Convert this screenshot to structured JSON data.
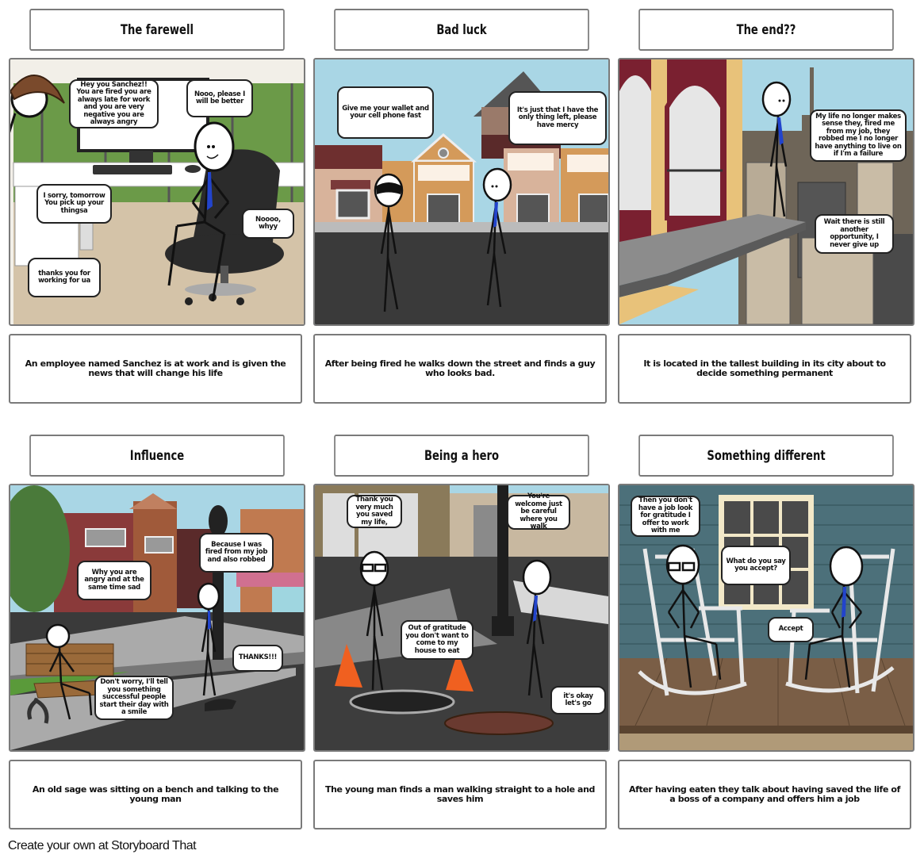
{
  "storyboard": {
    "cells": [
      {
        "title": "The farewell",
        "description": "An employee named Sanchez is at work and is given the news that will change his life",
        "bubbles": [
          "Hey you Sanchez!! You are fired you are always late for work and you are very negative you are always angry",
          "Nooo, please I will be better",
          "I sorry, tomorrow You pick up your thingsa",
          "Noooo, whyy",
          "thanks you for working for ua"
        ]
      },
      {
        "title": "Bad luck",
        "description": "After being fired he walks down the street and finds a guy who looks bad.",
        "bubbles": [
          "Give me your wallet and your cell phone fast",
          "It's just that I have the only thing left, please have mercy"
        ]
      },
      {
        "title": "The end??",
        "description": "It is located in the tallest building in its city about to decide something permanent",
        "bubbles": [
          "My life no longer makes sense they, fired me from my job, they robbed me I no longer have anything to live on if I'm a failure",
          "Wait there is still another opportunity, I never give up"
        ]
      },
      {
        "title": "Influence",
        "description": "An old sage was sitting on a bench and talking to the young man",
        "bubbles": [
          "Why you are angry and at the same time sad",
          "Because I was fired from my job and also robbed",
          "THANKS!!!",
          "Don't worry, I'll tell you something successful people start their day with a smile"
        ]
      },
      {
        "title": "Being a hero",
        "description": "The young man finds a man walking straight to a hole and saves him",
        "bubbles": [
          "Thank you very much you saved my life,",
          "You're welcome just be careful where you walk",
          "Out of gratitude you don't want to come to my house to eat",
          "it's okay let's go"
        ]
      },
      {
        "title": "Something different",
        "description": "After having eaten they talk about having saved the life of a boss of a company and offers him a job",
        "bubbles": [
          "Then you don't have a job look for gratitude I offer to work with me",
          "What do you say you accept?",
          "Accept"
        ]
      }
    ]
  },
  "footer": {
    "text": "Create your own at Storyboard That"
  },
  "colors": {
    "border": "#7a7a7a",
    "tie": "#2244cc",
    "sky": "#a9d6e5"
  }
}
